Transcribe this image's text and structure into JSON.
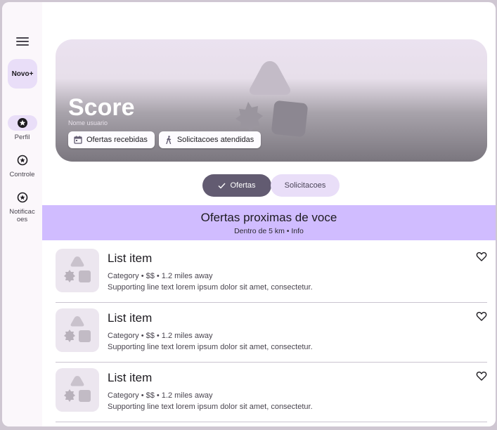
{
  "rail": {
    "fab_label": "Novo+",
    "items": [
      {
        "label": "Perfil",
        "icon": "star-circle-icon",
        "active": true
      },
      {
        "label": "Controle",
        "icon": "star-circle-icon",
        "active": false
      },
      {
        "label": "Notificac\noes",
        "icon": "star-circle-icon",
        "active": false
      }
    ]
  },
  "hero": {
    "title": "Score",
    "subtitle": "Nome usuario",
    "chips": [
      {
        "label": "Ofertas recebidas",
        "icon": "calendar-icon"
      },
      {
        "label": "Solicitacoes atendidas",
        "icon": "walk-icon"
      }
    ]
  },
  "segmented": {
    "selected": "Ofertas",
    "other": "Solicitacoes"
  },
  "banner": {
    "title": "Ofertas proximas de voce",
    "subtitle": "Dentro de 5 km  • Info"
  },
  "list": [
    {
      "title": "List item",
      "meta": "Category • $$ • 1.2 miles away",
      "text": "Supporting line text lorem ipsum dolor sit amet, consectetur."
    },
    {
      "title": "List item",
      "meta": "Category • $$ • 1.2 miles away",
      "text": "Supporting line text lorem ipsum dolor sit amet, consectetur."
    },
    {
      "title": "List item",
      "meta": "Category • $$ • 1.2 miles away",
      "text": "Supporting line text lorem ipsum dolor sit amet, consectetur."
    }
  ],
  "colors": {
    "primary": "#625b71",
    "secondary_container": "#e9def8",
    "banner": "#d0bcff"
  }
}
